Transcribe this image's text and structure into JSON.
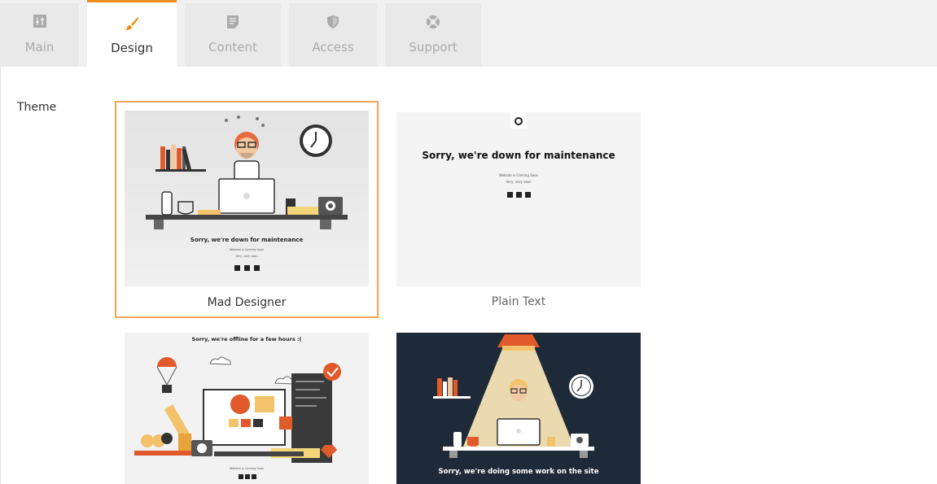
{
  "tabs": [
    {
      "label": "Main"
    },
    {
      "label": "Design"
    },
    {
      "label": "Content"
    },
    {
      "label": "Access"
    },
    {
      "label": "Support"
    }
  ],
  "theme": {
    "label": "Theme",
    "cards": [
      {
        "name": "Mad Designer",
        "heading": "Sorry, we're down for maintenance",
        "sub1": "Website is Coming Soon",
        "sub2": "Very, very soon"
      },
      {
        "name": "Plain Text",
        "heading": "Sorry, we're down for maintenance",
        "sub1": "Website is Coming Soon",
        "sub2": "Very, very soon"
      },
      {
        "heading": "Sorry, we're offline for a few hours :(",
        "sub1": "Website is Coming Soon"
      },
      {
        "heading": "Sorry, we're doing some work on the site"
      }
    ]
  },
  "colors": {
    "accent": "#f08c1e",
    "selected_border": "#f5a35c",
    "dark_bg": "#1f2a38"
  }
}
